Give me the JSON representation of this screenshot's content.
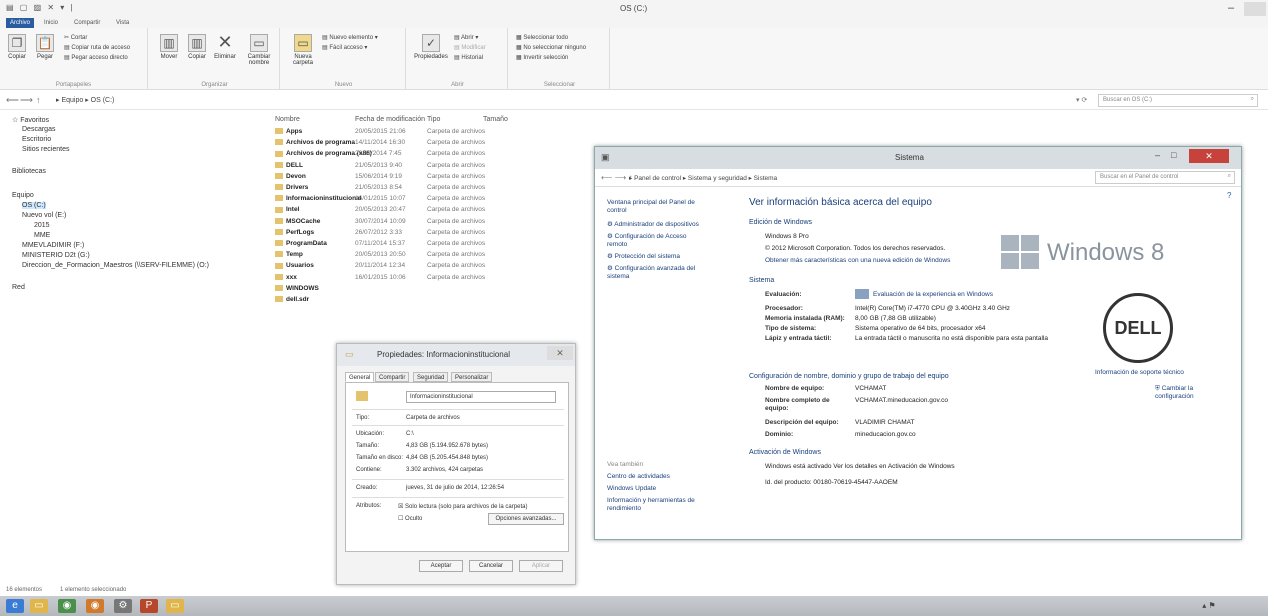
{
  "explorer": {
    "title": "OS (C:)",
    "qat_glyphs": "▤ ▢ ▨ ✕ ▾ |",
    "window_controls": {
      "minimize": "–",
      "maximize": "□"
    },
    "ribbon_tabs": [
      "Archivo",
      "Inicio",
      "Compartir",
      "Vista"
    ],
    "ribbon": {
      "portapapeles": {
        "group_label": "Portapapeles",
        "copy": "Copiar",
        "paste": "Pegar",
        "cut": "Cortar",
        "copy_path": "Copiar ruta de acceso",
        "paste_shortcut": "Pegar acceso directo"
      },
      "organizar": {
        "group_label": "Organizar",
        "move": "Mover",
        "copy_to": "Copiar",
        "delete": "Eliminar",
        "rename": "Cambiar nombre"
      },
      "nuevo": {
        "group_label": "Nuevo",
        "new_folder": "Nueva carpeta",
        "new_item": "Nuevo elemento ▾",
        "easy_access": "Fácil acceso ▾"
      },
      "abrir": {
        "group_label": "Abrir",
        "properties": "Propiedades",
        "open": "Abrir ▾",
        "modify": "Modificar",
        "history": "Historial"
      },
      "seleccionar": {
        "group_label": "Seleccionar",
        "select_all": "Seleccionar todo",
        "select_none": "No seleccionar ninguno",
        "invert": "Invertir selección"
      }
    },
    "address": {
      "back": "⟵",
      "forward": "⟶",
      "up": "↑",
      "path": "▸ Equipo ▸ OS (C:)",
      "refresh": "▾ ⟳",
      "search_placeholder": "Buscar en OS (C:)"
    },
    "nav": [
      {
        "label": "☆ Favoritos",
        "indent": 0
      },
      {
        "label": "Descargas",
        "indent": 1
      },
      {
        "label": "Escritorio",
        "indent": 1
      },
      {
        "label": "Sitios recientes",
        "indent": 1
      },
      {
        "label": "Bibliotecas",
        "indent": 0
      },
      {
        "label": "Equipo",
        "indent": 0
      },
      {
        "label": "OS (C:)",
        "indent": 1
      },
      {
        "label": "Nuevo vol (E:)",
        "indent": 1
      },
      {
        "label": "2015",
        "indent": 2
      },
      {
        "label": "MME",
        "indent": 2
      },
      {
        "label": "MMEVLADIMIR (F:)",
        "indent": 1
      },
      {
        "label": "MINISTERIO D2t (G:)",
        "indent": 1
      },
      {
        "label": "Direccion_de_Formacion_Maestros (\\\\SERV-FILEMME) (O:)",
        "indent": 1
      },
      {
        "label": "Red",
        "indent": 0
      }
    ],
    "columns": {
      "name": "Nombre",
      "date": "Fecha de modificación",
      "type": "Tipo",
      "size": "Tamaño"
    },
    "files": [
      {
        "name": "Apps",
        "date": "20/05/2015 21:06",
        "type": "Carpeta de archivos"
      },
      {
        "name": "Archivos de programa",
        "date": "14/11/2014 16:30",
        "type": "Carpeta de archivos"
      },
      {
        "name": "Archivos de programa (x86)",
        "date": "20/11/2014 7:45",
        "type": "Carpeta de archivos"
      },
      {
        "name": "DELL",
        "date": "21/05/2013 9:40",
        "type": "Carpeta de archivos"
      },
      {
        "name": "Devon",
        "date": "15/06/2014 9:19",
        "type": "Carpeta de archivos"
      },
      {
        "name": "Drivers",
        "date": "21/05/2013 8:54",
        "type": "Carpeta de archivos"
      },
      {
        "name": "Informacioninstitucional",
        "date": "16/01/2015 10:07",
        "type": "Carpeta de archivos"
      },
      {
        "name": "Intel",
        "date": "20/05/2013 20:47",
        "type": "Carpeta de archivos"
      },
      {
        "name": "MSOCache",
        "date": "30/07/2014 10:09",
        "type": "Carpeta de archivos"
      },
      {
        "name": "PerfLogs",
        "date": "26/07/2012 3:33",
        "type": "Carpeta de archivos"
      },
      {
        "name": "ProgramData",
        "date": "07/11/2014 15:37",
        "type": "Carpeta de archivos"
      },
      {
        "name": "Temp",
        "date": "20/05/2013 20:50",
        "type": "Carpeta de archivos"
      },
      {
        "name": "Usuarios",
        "date": "20/11/2014 12:34",
        "type": "Carpeta de archivos"
      },
      {
        "name": "xxx",
        "date": "16/01/2015 10:06",
        "type": "Carpeta de archivos"
      },
      {
        "name": "WINDOWS",
        "date": "",
        "type": ""
      },
      {
        "name": "dell.sdr",
        "date": "",
        "type": ""
      }
    ],
    "status": {
      "count": "16 elementos",
      "selected": "1 elemento seleccionado"
    }
  },
  "system_window": {
    "title": "Sistema",
    "window_controls": {
      "minimize": "–",
      "maximize": "□",
      "close": "✕"
    },
    "address": "▸ Panel de control ▸ Sistema y seguridad ▸ Sistema",
    "search_placeholder": "Buscar en el Panel de control",
    "left_links": [
      "Ventana principal del Panel de control",
      "Administrador de dispositivos",
      "Configuración de Acceso remoto",
      "Protección del sistema",
      "Configuración avanzada del sistema"
    ],
    "see_also": "Vea también",
    "see_also_links": [
      "Centro de actividades",
      "Windows Update",
      "Información y herramientas de rendimiento"
    ],
    "heading": "Ver información básica acerca del equipo",
    "edition_section": "Edición de Windows",
    "edition": "Windows 8 Pro",
    "copyright": "© 2012 Microsoft Corporation. Todos los derechos reservados.",
    "more_features": "Obtener más características con una nueva edición de Windows",
    "windows_logo_text": "Windows 8",
    "system_section": "Sistema",
    "rating_label": "Evaluación:",
    "rating_value": "Evaluación de la experiencia en Windows",
    "processor_label": "Procesador:",
    "processor_value": "Intel(R) Core(TM) i7-4770 CPU @ 3.40GHz   3.40 GHz",
    "ram_label": "Memoria instalada (RAM):",
    "ram_value": "8,00 GB (7,88 GB utilizable)",
    "type_label": "Tipo de sistema:",
    "type_value": "Sistema operativo de 64 bits, procesador x64",
    "pen_label": "Lápiz y entrada táctil:",
    "pen_value": "La entrada táctil o manuscrita no está disponible para esta pantalla",
    "dell_logo": "DELL",
    "support_link": "Información de soporte técnico",
    "computer_section": "Configuración de nombre, dominio y grupo de trabajo del equipo",
    "name_label": "Nombre de equipo:",
    "name_value": "VCHAMAT",
    "fullname_label": "Nombre completo de equipo:",
    "fullname_value": "VCHAMAT.mineducacion.gov.co",
    "desc_label": "Descripción del equipo:",
    "desc_value": "VLADIMIR CHAMAT",
    "domain_label": "Dominio:",
    "domain_value": "mineducacion.gov.co",
    "change_settings": "Cambiar la configuración",
    "activation_section": "Activación de Windows",
    "activation_value": "Windows está activado   Ver los detalles en Activación de Windows",
    "product_id": "Id. del producto: 00180-70619-45447-AAOEM"
  },
  "properties_dialog": {
    "title": "Propiedades: Informacioninstitucional",
    "close": "✕",
    "tabs": [
      "General",
      "Compartir",
      "Seguridad",
      "Personalizar"
    ],
    "folder_name": "Informacioninstitucional",
    "type_label": "Tipo:",
    "type_value": "Carpeta de archivos",
    "location_label": "Ubicación:",
    "location_value": "C:\\",
    "size_label": "Tamaño:",
    "size_value": "4,83 GB (5.194.952.678 bytes)",
    "disk_label": "Tamaño en disco:",
    "disk_value": "4,84 GB (5.205.454.848 bytes)",
    "contains_label": "Contiene:",
    "contains_value": "3.302 archivos, 424 carpetas",
    "created_label": "Creado:",
    "created_value": "jueves, 31 de julio de 2014, 12:26:54",
    "attrs_label": "Atributos:",
    "readonly": "Solo lectura (solo para archivos de la carpeta)",
    "hidden": "Oculto",
    "advanced": "Opciones avanzadas...",
    "ok": "Aceptar",
    "cancel": "Cancelar",
    "apply": "Aplicar"
  }
}
